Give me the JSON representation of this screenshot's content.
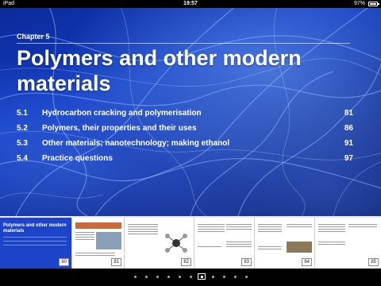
{
  "status_bar": {
    "carrier": "iPad",
    "time": "19:57",
    "battery": "97%",
    "battery_level": 0.97
  },
  "chapter": {
    "label": "Chapter 5",
    "title": "Polymers and other modern materials"
  },
  "toc": [
    {
      "num": "5.1",
      "text": "Hydrocarbon cracking and polymerisation",
      "page": "81"
    },
    {
      "num": "5.2",
      "text": "Polymers, their properties and their uses",
      "page": "86"
    },
    {
      "num": "5.3",
      "text": "Other materials; nanotechnology; making ethanol",
      "page": "91"
    },
    {
      "num": "5.4",
      "text": "Practice questions",
      "page": "97"
    }
  ],
  "thumbnails": {
    "cover_title": "Polymers and other modern materials",
    "pages": [
      "80",
      "81",
      "82",
      "83",
      "84",
      "85"
    ]
  },
  "pager": {
    "count": 11,
    "active_index": 6
  }
}
